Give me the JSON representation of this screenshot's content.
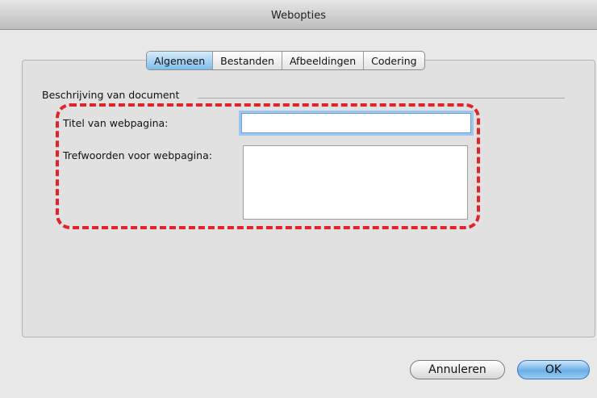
{
  "window": {
    "title": "Webopties"
  },
  "tabs": [
    {
      "label": "Algemeen",
      "active": true
    },
    {
      "label": "Bestanden",
      "active": false
    },
    {
      "label": "Afbeeldingen",
      "active": false
    },
    {
      "label": "Codering",
      "active": false
    }
  ],
  "group": {
    "label": "Beschrijving van document",
    "title_label": "Titel van webpagina:",
    "title_value": "",
    "keywords_label": "Trefwoorden voor webpagina:",
    "keywords_value": ""
  },
  "buttons": {
    "cancel": "Annuleren",
    "ok": "OK"
  },
  "colors": {
    "highlight_dash": "#e0242a",
    "focus_ring": "#9cc5ef",
    "default_button": "#6aaee6"
  }
}
